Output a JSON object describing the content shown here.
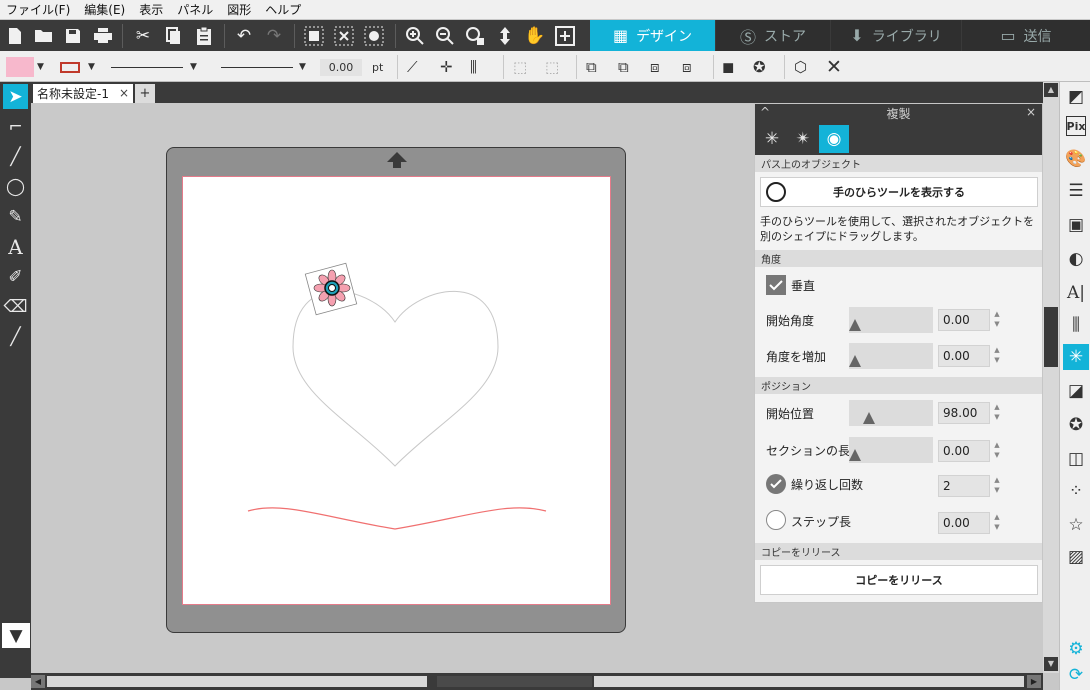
{
  "menu": [
    "ファイル(F)",
    "編集(E)",
    "表示",
    "パネル",
    "図形",
    "ヘルプ"
  ],
  "mode_tabs": [
    {
      "label": "デザイン",
      "icon": "grid-icon",
      "active": true
    },
    {
      "label": "ストア",
      "icon": "store-icon",
      "active": false
    },
    {
      "label": "ライブラリ",
      "icon": "library-icon",
      "active": false
    },
    {
      "label": "送信",
      "icon": "send-icon",
      "active": false
    }
  ],
  "toolbar2": {
    "line_width_value": "0.00",
    "line_width_unit": "pt",
    "fill_color": "#f7b8cc",
    "stroke_color": "#c0392b"
  },
  "document": {
    "tab_label": "名称未設定-1",
    "tab_close": "×",
    "add_tab": "+"
  },
  "panel": {
    "title": "複製",
    "collapse": "^",
    "close": "×",
    "section_object_on_path": "パス上のオブジェクト",
    "show_hand_tool_button": "手のひらツールを表示する",
    "description": "手のひらツールを使用して、選択されたオブジェクトを別のシェイプにドラッグします。",
    "section_angle": "角度",
    "vertical_label": "垂直",
    "vertical_checked": true,
    "start_angle_label": "開始角度",
    "start_angle_value": "0.00",
    "increase_angle_label": "角度を増加",
    "increase_angle_value": "0.00",
    "section_position": "ポジション",
    "start_position_label": "開始位置",
    "start_position_value": "98.00",
    "section_length_label": "セクションの長さ",
    "section_length_value": "0.00",
    "repeat_count_label": "繰り返し回数",
    "repeat_count_value": "2",
    "repeat_checked": true,
    "step_length_label": "ステップ長",
    "step_length_value": "0.00",
    "section_release": "コピーをリリース",
    "release_copies_button": "コピーをリリース"
  },
  "colors": {
    "accent": "#13b3d8",
    "dark_bg": "#3a3a3a",
    "mat_gray": "#909090",
    "cut_line": "#e57b8a"
  }
}
